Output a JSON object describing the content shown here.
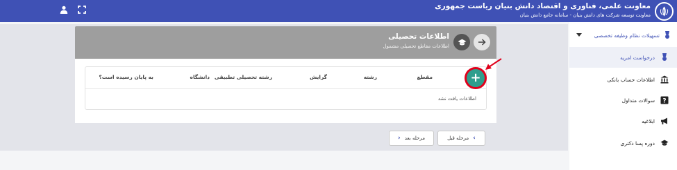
{
  "header": {
    "title": "معاونت علمی، فناوری و اقتصاد دانش بنیان ریاست جمهوری",
    "subtitle": "معاونت توسعه شرکت های دانش بنیان - سامانه جامع دانش بنیان",
    "bg_color": "#3f51b5"
  },
  "sidebar": {
    "section_label": "تسهیلات نظام وظیفه تخصصی",
    "items": [
      {
        "label": "درخواست امریه",
        "icon": "medal-icon",
        "active": true
      },
      {
        "label": "اطلاعات حساب بانکی",
        "icon": "bank-icon"
      },
      {
        "label": "سوالات متداول",
        "icon": "help-icon"
      },
      {
        "label": "ابلاغیه",
        "icon": "megaphone-icon"
      },
      {
        "label": "دوره پسا دکتری",
        "icon": "graduation-cap-icon"
      }
    ]
  },
  "card": {
    "title": "اطلاعات تحصیلی",
    "subtitle": "اطلاعات مقاطع تحصیلی مشمول",
    "columns": [
      "مقطع",
      "رشته",
      "گرایش",
      "رشته تحصیلی تطبیقی",
      "دانشگاه",
      "به پایان رسیده است؟"
    ],
    "empty_message": "اطلاعات یافت نشد",
    "add_button": "+"
  },
  "footer": {
    "prev_label": "مرحله قبل",
    "next_label": "مرحله بعد"
  },
  "colors": {
    "accent": "#3f51b5",
    "add_button": "#2e9e8d",
    "highlight": "#e0001b"
  }
}
